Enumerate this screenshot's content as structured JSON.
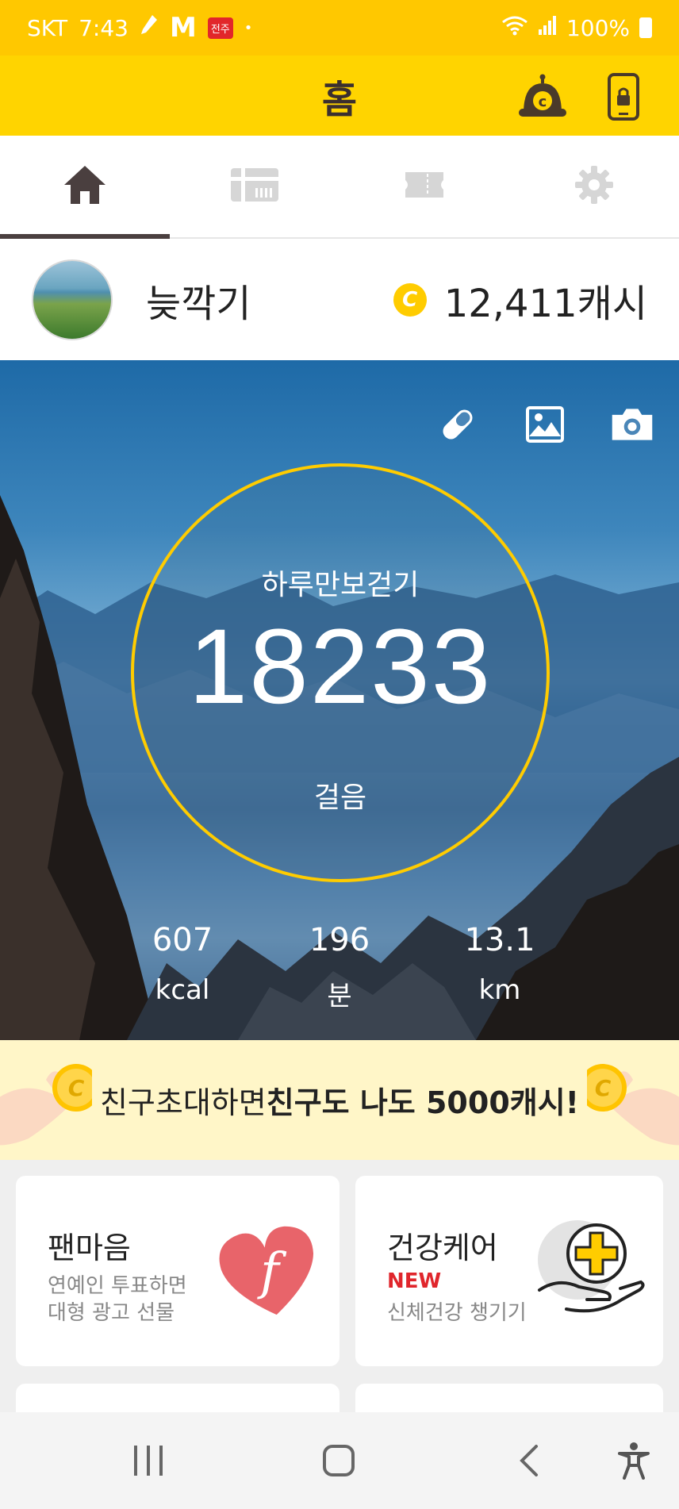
{
  "status_bar": {
    "carrier": "SKT",
    "time": "7:43",
    "m_badge": "M",
    "app_badge": "전주",
    "dot": "•",
    "battery": "100%"
  },
  "header": {
    "title": "홈"
  },
  "tabs": [
    {
      "name": "home",
      "icon": "home-icon",
      "active": true
    },
    {
      "name": "gift-shop",
      "icon": "gift-card-icon",
      "active": false
    },
    {
      "name": "coupon",
      "icon": "ticket-icon",
      "active": false
    },
    {
      "name": "settings",
      "icon": "gear-icon",
      "active": false
    }
  ],
  "profile": {
    "username": "늦깍기",
    "coin_symbol": "C",
    "cash": "12,411캐시"
  },
  "hero": {
    "title": "하루만보걷기",
    "steps": "18233",
    "steps_unit": "걸음",
    "stats": [
      {
        "value": "607",
        "unit": "kcal"
      },
      {
        "value": "196",
        "unit": "분"
      },
      {
        "value": "13.1",
        "unit": "km"
      }
    ]
  },
  "invite": {
    "text_plain": "친구초대하면 ",
    "text_bold": "친구도 나도 5000캐시!"
  },
  "cards": [
    {
      "title": "팬마음",
      "sub1": "연예인 투표하면",
      "sub2": "대형 광고 선물"
    },
    {
      "title": "건강케어",
      "badge": "NEW",
      "sub1": "신체건강 챙기기"
    }
  ],
  "colors": {
    "brand_yellow": "#ffd400",
    "status_yellow": "#ffc800",
    "ring": "#ffcc00",
    "new_red": "#e0262c"
  }
}
